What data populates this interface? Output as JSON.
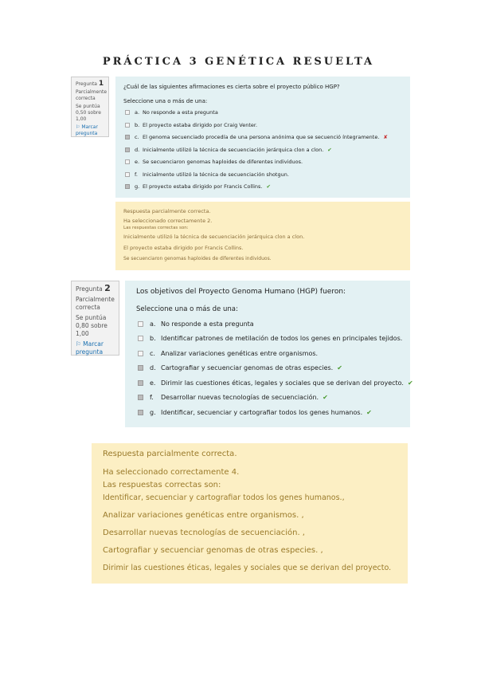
{
  "title": "PRÁCTICA 3 GENÉTICA RESUELTA",
  "q1": {
    "info": {
      "label": "Pregunta",
      "number": "1",
      "state": "Parcialmente correcta",
      "score": "Se puntúa 0,50 sobre 1,00",
      "flag": "Marcar pregunta"
    },
    "text": "¿Cuál de las siguientes afirmaciones es cierta sobre el proyecto público HGP?",
    "instruction": "Seleccione una o más de una:",
    "options": [
      {
        "letter": "a.",
        "text": "No responde a esta pregunta",
        "checked": false,
        "mark": ""
      },
      {
        "letter": "b.",
        "text": "El proyecto estaba dirigido por Craig Venter.",
        "checked": false,
        "mark": ""
      },
      {
        "letter": "c.",
        "text": "El genoma secuenciado procedía de una persona anónima que se secuenció íntegramente.",
        "checked": true,
        "mark": "✘"
      },
      {
        "letter": "d.",
        "text": "Inicialmente utilizó la técnica de secuenciación jerárquica clon a clon.",
        "checked": true,
        "mark": "✔"
      },
      {
        "letter": "e.",
        "text": "Se secuenciaron genomas haploides de diferentes individuos.",
        "checked": false,
        "mark": ""
      },
      {
        "letter": "f.",
        "text": "Inicialmente utilizó la técnica de secuenciación shotgun.",
        "checked": false,
        "mark": ""
      },
      {
        "letter": "g.",
        "text": "El proyecto estaba dirigido por Francis Collins.",
        "checked": true,
        "mark": "✔"
      }
    ],
    "feedback": {
      "line1": "Respuesta parcialmente correcta.",
      "line2": "Ha seleccionado correctamente 2.",
      "line3": "Las respuestas correctas son:",
      "line4": "Inicialmente utilizó la técnica de secuenciación jerárquica clon a clon.",
      "line5": "El proyecto estaba dirigido por Francis Collins.",
      "line6": "Se secuenciaron genomas haploides de diferentes individuos."
    }
  },
  "q2": {
    "info": {
      "label": "Pregunta",
      "number": "2",
      "state": "Parcialmente correcta",
      "score": "Se puntúa 0,80 sobre 1,00",
      "flag": "Marcar pregunta"
    },
    "text": "Los objetivos del Proyecto Genoma Humano (HGP) fueron:",
    "instruction": "Seleccione una o más de una:",
    "options": [
      {
        "letter": "a.",
        "text": "No responde a esta pregunta",
        "checked": false,
        "mark": ""
      },
      {
        "letter": "b.",
        "text": "Identificar patrones de metilación de todos los genes en principales tejidos.",
        "checked": false,
        "mark": ""
      },
      {
        "letter": "c.",
        "text": "Analizar variaciones genéticas entre organismos.",
        "checked": false,
        "mark": ""
      },
      {
        "letter": "d.",
        "text": "Cartografiar y secuenciar genomas de otras especies.",
        "checked": true,
        "mark": "✔"
      },
      {
        "letter": "e.",
        "text": "Dirimir las cuestiones éticas, legales y sociales que se derivan del proyecto.",
        "checked": true,
        "mark": "✔"
      },
      {
        "letter": "f.",
        "text": "Desarrollar nuevas tecnologías de secuenciación.",
        "checked": true,
        "mark": "✔"
      },
      {
        "letter": "g.",
        "text": "Identificar, secuenciar y cartografiar todos los genes humanos.",
        "checked": true,
        "mark": "✔"
      }
    ],
    "feedback": {
      "line1": "Respuesta parcialmente correcta.",
      "line2": "Ha seleccionado correctamente 4.",
      "line3": "Las respuestas correctas son:",
      "line4": "Identificar, secuenciar y cartografiar todos los genes humanos.,",
      "line5": "Analizar variaciones genéticas entre organismos. ,",
      "line6": "Desarrollar nuevas tecnologías de secuenciación. ,",
      "line7": "Cartografiar y secuenciar genomas de otras especies. ,",
      "line8": "Dirimir las cuestiones éticas, legales y sociales que se derivan del proyecto."
    }
  }
}
